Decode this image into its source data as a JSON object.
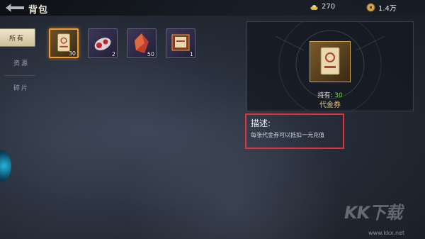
{
  "header": {
    "title": "背包",
    "currencies": [
      {
        "icon": "gold-ingot-icon",
        "value": "270"
      },
      {
        "icon": "copper-coin-icon",
        "value": "1.4万"
      }
    ]
  },
  "tabs": [
    {
      "label": "所有",
      "active": true
    },
    {
      "label": "资源",
      "active": false
    },
    {
      "label": "碎片",
      "active": false
    }
  ],
  "inventory": [
    {
      "name": "代金券",
      "icon": "voucher-scroll-icon",
      "count": "30",
      "selected": true
    },
    {
      "name": "",
      "icon": "red-potion-bundle-icon",
      "count": "2",
      "selected": false
    },
    {
      "name": "",
      "icon": "red-crystal-icon",
      "count": "50",
      "selected": false
    },
    {
      "name": "",
      "icon": "scroll-box-icon",
      "count": "1",
      "selected": false
    }
  ],
  "detail": {
    "owned_label": "持有:",
    "owned_count": "30",
    "item_name": "代金券",
    "desc_title": "描述:",
    "desc_text": "每张代金券可以抵扣一元充值"
  },
  "colors": {
    "selected_border": "#f29a2e",
    "owned_count": "#69d44a",
    "item_name": "#e8c77a",
    "highlight_box": "#e2333b"
  },
  "watermark": {
    "logo": "KK下载",
    "url": "www.kkx.net"
  }
}
